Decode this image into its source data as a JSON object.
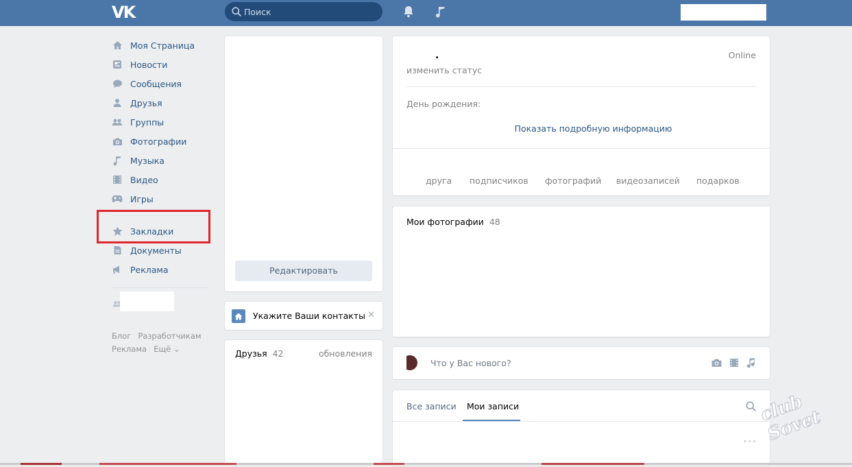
{
  "header": {
    "logo": "VK",
    "search_placeholder": "Поиск"
  },
  "sidebar": {
    "items": [
      {
        "label": "Моя Страница",
        "icon": "home-icon"
      },
      {
        "label": "Новости",
        "icon": "news-icon"
      },
      {
        "label": "Сообщения",
        "icon": "messages-icon"
      },
      {
        "label": "Друзья",
        "icon": "friends-icon"
      },
      {
        "label": "Группы",
        "icon": "groups-icon"
      },
      {
        "label": "Фотографии",
        "icon": "camera-icon"
      },
      {
        "label": "Музыка",
        "icon": "music-icon"
      },
      {
        "label": "Видео",
        "icon": "video-icon"
      },
      {
        "label": "Игры",
        "icon": "games-icon"
      }
    ],
    "items2": [
      {
        "label": "Закладки",
        "icon": "star-icon"
      },
      {
        "label": "Документы",
        "icon": "document-icon"
      },
      {
        "label": "Реклама",
        "icon": "ads-icon"
      }
    ],
    "footer": {
      "blog": "Блог",
      "developers": "Разработчикам",
      "ads": "Реклама",
      "more": "Ещё ⌄"
    }
  },
  "profile": {
    "name": ".",
    "online": "Online",
    "status_link": "изменить статус",
    "birthday_label": "День рождения:",
    "show_more": "Показать подробную информацию",
    "counters": [
      "друга",
      "подписчиков",
      "фотографий",
      "видеозаписей",
      "подарков"
    ]
  },
  "avatar_card": {
    "edit_button": "Редактировать"
  },
  "contacts_card": {
    "text": "Укажите Ваши контакты",
    "close": "✕"
  },
  "friends_card": {
    "title": "Друзья",
    "count": "42",
    "updates": "обновления"
  },
  "photos_card": {
    "title": "Мои фотографии",
    "count": "48"
  },
  "post_box": {
    "placeholder": "Что у Вас нового?"
  },
  "wall_tabs": {
    "all": "Все записи",
    "mine": "Мои записи",
    "more": "•••"
  },
  "watermark": "club Sovet",
  "colors": {
    "topbar": "#4a76a8",
    "link": "#2a5885",
    "highlight": "#e0262d",
    "background": "#edeef0"
  }
}
